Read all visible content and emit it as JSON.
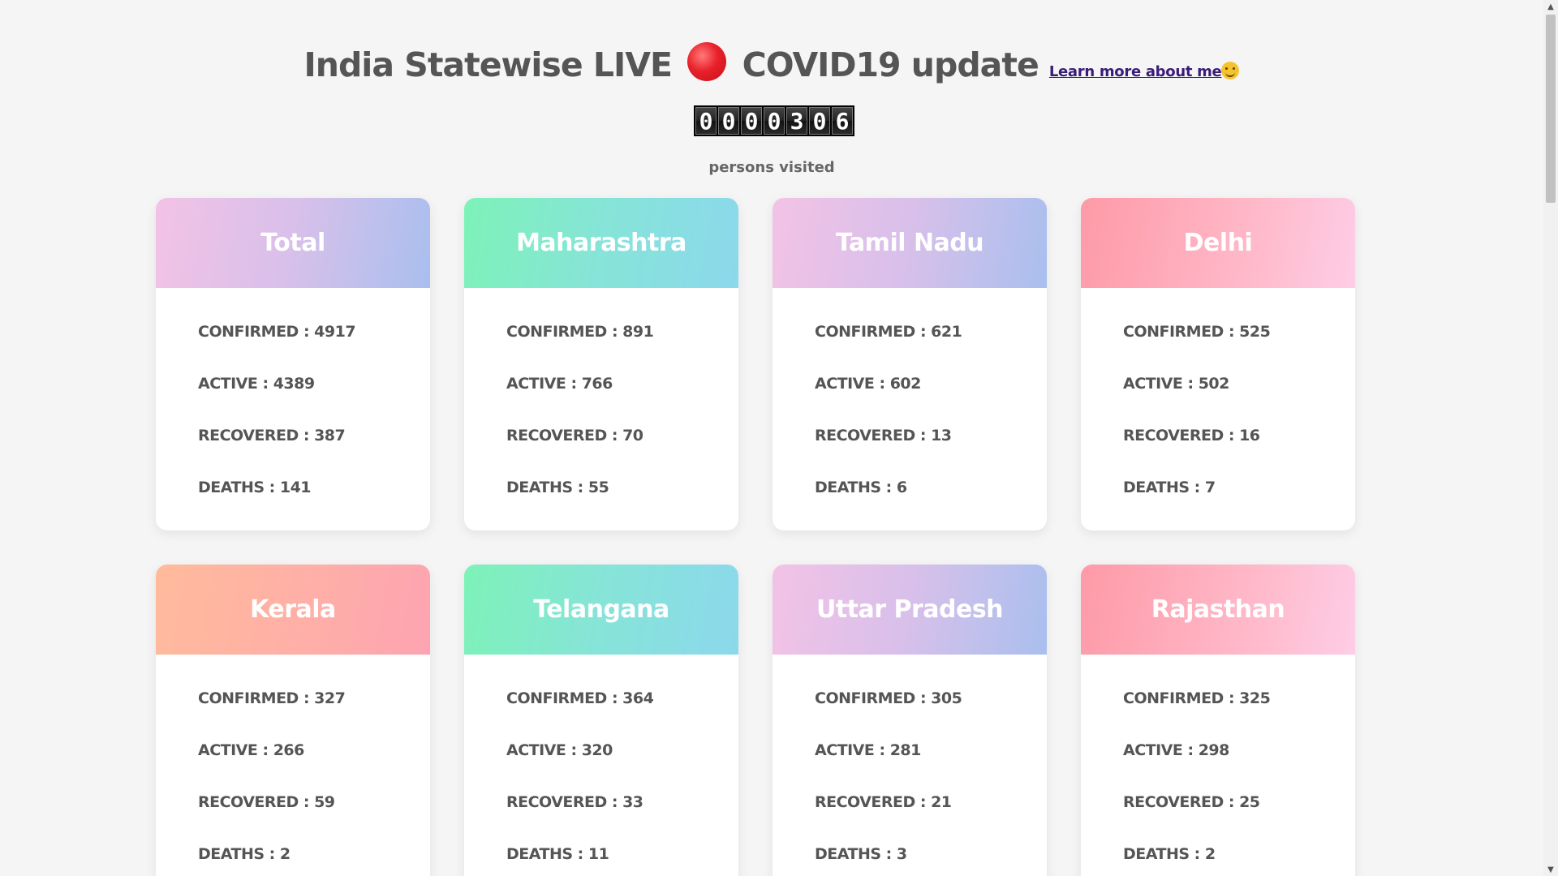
{
  "header": {
    "title_before": "India Statewise LIVE",
    "title_after": "COVID19 update",
    "learn_link": "Learn more about me"
  },
  "counter": {
    "digits": [
      "0",
      "0",
      "0",
      "0",
      "3",
      "0",
      "6"
    ],
    "caption": "persons visited"
  },
  "cards": [
    {
      "name": "Total",
      "gradient": "purple",
      "confirmed": "CONFIRMED : 4917",
      "active": "ACTIVE : 4389",
      "recovered": "RECOVERED : 387",
      "deaths": "DEATHS : 141"
    },
    {
      "name": "Maharashtra",
      "gradient": "teal",
      "confirmed": "CONFIRMED : 891",
      "active": "ACTIVE : 766",
      "recovered": "RECOVERED : 70",
      "deaths": "DEATHS : 55"
    },
    {
      "name": "Tamil Nadu",
      "gradient": "purple",
      "confirmed": "CONFIRMED : 621",
      "active": "ACTIVE : 602",
      "recovered": "RECOVERED : 13",
      "deaths": "DEATHS : 6"
    },
    {
      "name": "Delhi",
      "gradient": "pink",
      "confirmed": "CONFIRMED : 525",
      "active": "ACTIVE : 502",
      "recovered": "RECOVERED : 16",
      "deaths": "DEATHS : 7"
    },
    {
      "name": "Kerala",
      "gradient": "peach",
      "confirmed": "CONFIRMED : 327",
      "active": "ACTIVE : 266",
      "recovered": "RECOVERED : 59",
      "deaths": "DEATHS : 2"
    },
    {
      "name": "Telangana",
      "gradient": "teal",
      "confirmed": "CONFIRMED : 364",
      "active": "ACTIVE : 320",
      "recovered": "RECOVERED : 33",
      "deaths": "DEATHS : 11"
    },
    {
      "name": "Uttar Pradesh",
      "gradient": "purple",
      "confirmed": "CONFIRMED : 305",
      "active": "ACTIVE : 281",
      "recovered": "RECOVERED : 21",
      "deaths": "DEATHS : 3"
    },
    {
      "name": "Rajasthan",
      "gradient": "pink",
      "confirmed": "CONFIRMED : 325",
      "active": "ACTIVE : 298",
      "recovered": "RECOVERED : 25",
      "deaths": "DEATHS : 2"
    }
  ]
}
